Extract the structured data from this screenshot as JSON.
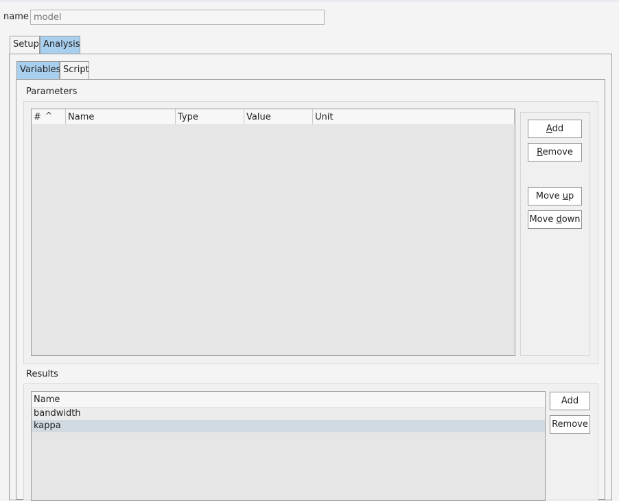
{
  "form": {
    "name_label": "name",
    "name_placeholder": "model",
    "name_value": ""
  },
  "main_tabs": [
    {
      "label": "Setup",
      "active": false
    },
    {
      "label": "Analysis",
      "active": true
    }
  ],
  "sub_tabs": [
    {
      "label": "Variables",
      "active": true
    },
    {
      "label": "Script",
      "active": false
    }
  ],
  "parameters": {
    "title": "Parameters",
    "columns": [
      "#",
      "Name",
      "Type",
      "Value",
      "Unit"
    ],
    "sort_indicator": "^",
    "rows": [],
    "buttons": {
      "add": {
        "pre": "",
        "key": "A",
        "post": "dd"
      },
      "remove": {
        "pre": "",
        "key": "R",
        "post": "emove"
      },
      "move_up": {
        "pre": "Move ",
        "key": "u",
        "post": "p"
      },
      "move_down": {
        "pre": "Move ",
        "key": "d",
        "post": "own"
      }
    }
  },
  "results": {
    "title": "Results",
    "columns": [
      "Name"
    ],
    "rows": [
      "bandwidth",
      "kappa"
    ],
    "selected_row": 1,
    "buttons": {
      "add": "Add",
      "remove": "Remove"
    }
  },
  "colors": {
    "active_tab": "#a9cfee",
    "selected_row": "#d1dae1",
    "table_bg": "#e6e6e6",
    "window_bg": "#f4f4f4"
  }
}
